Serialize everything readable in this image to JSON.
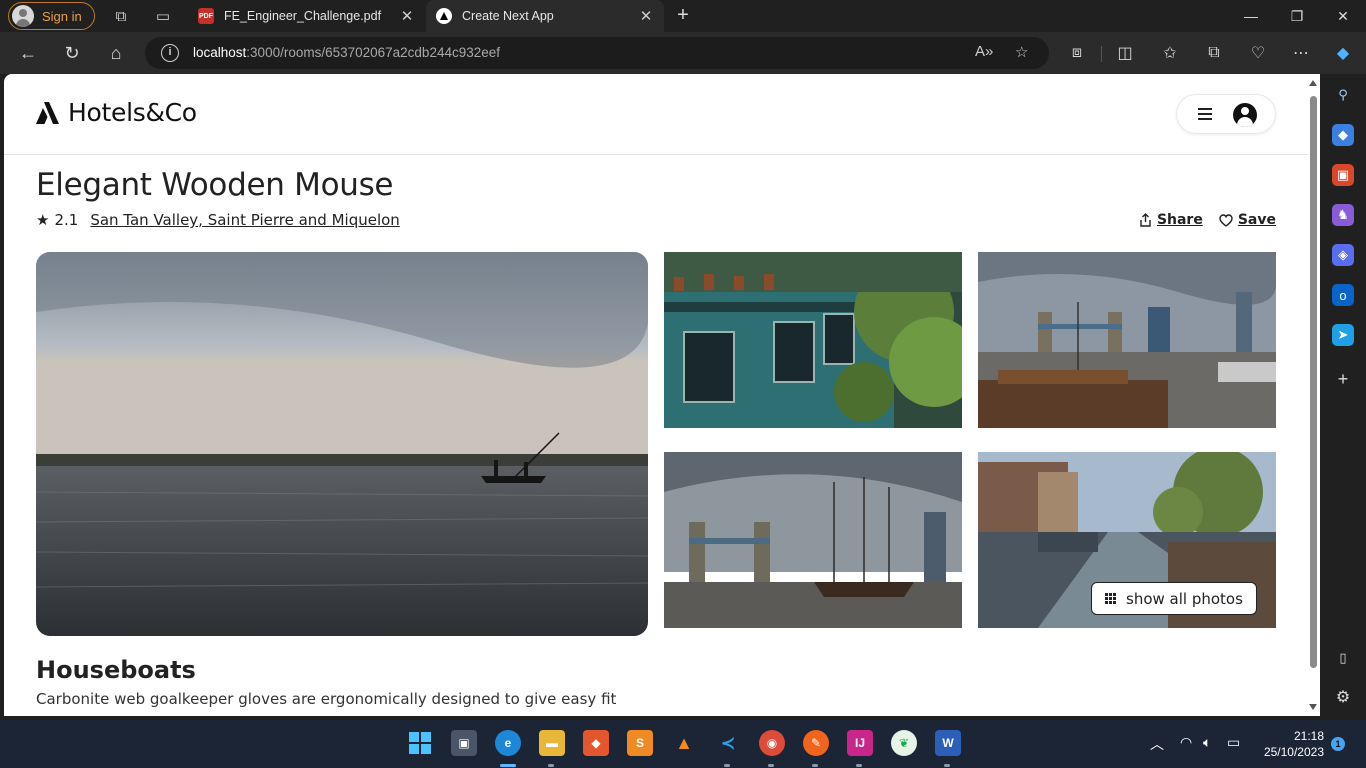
{
  "browser": {
    "signin_label": "Sign in",
    "tabs": [
      {
        "title": "FE_Engineer_Challenge.pdf",
        "favicon": "PDF"
      },
      {
        "title": "Create Next App"
      }
    ],
    "url_host": "localhost",
    "url_rest": ":3000/rooms/653702067a2cdb244c932eef"
  },
  "site": {
    "brand": "Hotels&Co"
  },
  "room": {
    "title": "Elegant Wooden Mouse",
    "rating": "2.1",
    "location": "San Tan Valley, Saint Pierre and Miquelon",
    "share_label": "Share",
    "save_label": "Save",
    "show_all_label": "show all photos",
    "category": "Houseboats",
    "description": "Carbonite web goalkeeper gloves are ergonomically designed to give easy fit"
  },
  "taskbar": {
    "time": "21:18",
    "date": "25/10/2023",
    "notification_count": "1"
  },
  "colors": {
    "signin_accent": "#e8a04a",
    "taskbar_bg": "#1b2536"
  }
}
